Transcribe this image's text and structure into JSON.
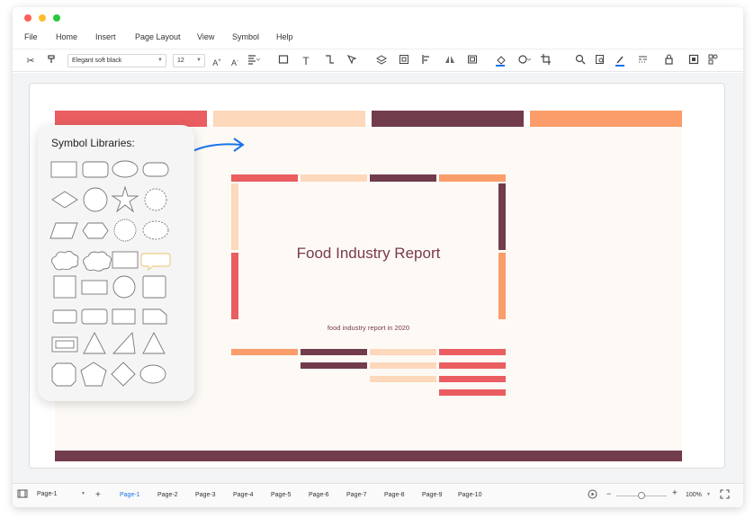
{
  "window": {
    "controls": {
      "close_color": "#ff5f57",
      "minimize_color": "#febc2e",
      "maximize_color": "#28c840"
    }
  },
  "menu": {
    "items": [
      "File",
      "Home",
      "Insert",
      "Page Layout",
      "View",
      "Symbol",
      "Help"
    ]
  },
  "toolbar": {
    "font_name": "Elegant soft black",
    "font_size": "12",
    "icons": [
      "scissors-icon",
      "format-painter-icon",
      "font-grow-icon",
      "font-shrink-icon",
      "align-icon",
      "rectangle-icon",
      "text-icon",
      "connector-icon",
      "pointer-icon",
      "layers-icon",
      "group-icon",
      "align-left-icon",
      "flip-icon",
      "frame-icon",
      "fill-icon",
      "shadow-icon",
      "crop-icon",
      "search-icon",
      "zoom-page-icon",
      "line-color-icon",
      "line-style-icon",
      "lock-icon",
      "fit-icon",
      "more-icon"
    ]
  },
  "symbol_panel": {
    "title": "Symbol Libraries:"
  },
  "document": {
    "title": "Food Industry Report",
    "subtitle": "food industry report in 2020",
    "colors": {
      "red": "#ea5d60",
      "peach": "#fdd8bb",
      "plum": "#713c4c",
      "orange": "#fa9d6a",
      "background": "#fdfaf6",
      "title": "#7a3a4c",
      "arrow": "#1a73e8"
    }
  },
  "statusbar": {
    "page_select": "Page-1",
    "add_label": "+",
    "pages": [
      "Page-1",
      "Page-2",
      "Page-3",
      "Page-4",
      "Page-5",
      "Page-6",
      "Page-7",
      "Page-8",
      "Page-9",
      "Page-10"
    ],
    "active_page": "Page-1",
    "zoom": "100%",
    "zoom_minus": "−",
    "zoom_plus": "+",
    "zoom_level": 0.5
  }
}
